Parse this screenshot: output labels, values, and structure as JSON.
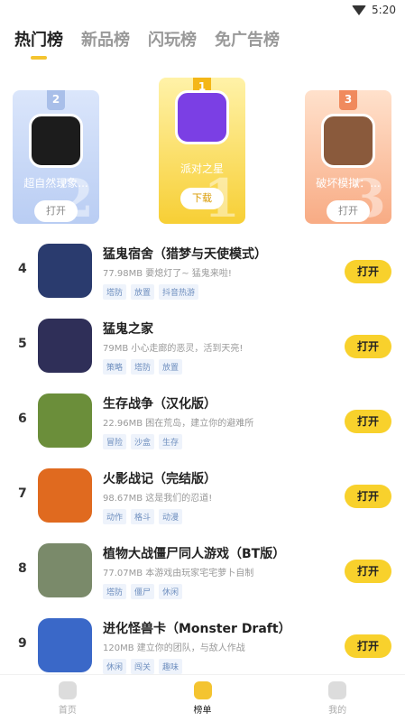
{
  "status": {
    "time": "5:20"
  },
  "tabs": [
    "热门榜",
    "新品榜",
    "闪玩榜",
    "免广告榜"
  ],
  "podium": [
    {
      "rank": "2",
      "name": "超自然现象...",
      "button": "打开",
      "icon_color": "#1c1c1c"
    },
    {
      "rank": "1",
      "name": "派对之星",
      "button": "下载",
      "icon_color": "#7b3fe4"
    },
    {
      "rank": "3",
      "name": "破坏模拟：...",
      "button": "打开",
      "icon_color": "#8a5a3c"
    }
  ],
  "list": [
    {
      "rank": "4",
      "title": "猛鬼宿舍（猎梦与天使模式）",
      "sub": "77.98MB 要熄灯了~ 猛鬼来啦!",
      "tags": [
        "塔防",
        "放置",
        "抖音热游"
      ],
      "button": "打开",
      "icon_color": "#2a3b6e"
    },
    {
      "rank": "5",
      "title": "猛鬼之家",
      "sub": "79MB 小心走廊的恶灵，活到天亮!",
      "tags": [
        "策略",
        "塔防",
        "放置"
      ],
      "button": "打开",
      "icon_color": "#2f2f58"
    },
    {
      "rank": "6",
      "title": "生存战争（汉化版）",
      "sub": "22.96MB 困在荒岛，建立你的避难所",
      "tags": [
        "冒险",
        "沙盒",
        "生存"
      ],
      "button": "打开",
      "icon_color": "#6b8e3a"
    },
    {
      "rank": "7",
      "title": "火影战记（完结版）",
      "sub": "98.67MB 这是我们的忍道!",
      "tags": [
        "动作",
        "格斗",
        "动漫"
      ],
      "button": "打开",
      "icon_color": "#e06a1f"
    },
    {
      "rank": "8",
      "title": "植物大战僵尸同人游戏（BT版）",
      "sub": "77.07MB 本游戏由玩家宅宅萝卜自制",
      "tags": [
        "塔防",
        "僵尸",
        "休闲"
      ],
      "button": "打开",
      "icon_color": "#7a8a6a"
    },
    {
      "rank": "9",
      "title": "进化怪兽卡（Monster Draft）",
      "sub": "120MB 建立你的团队，与敌人作战",
      "tags": [
        "休闲",
        "闯关",
        "趣味"
      ],
      "button": "打开",
      "icon_color": "#3a68c8"
    }
  ],
  "nav": [
    {
      "label": "首页",
      "active": false
    },
    {
      "label": "榜单",
      "active": true
    },
    {
      "label": "我的",
      "active": false
    }
  ]
}
